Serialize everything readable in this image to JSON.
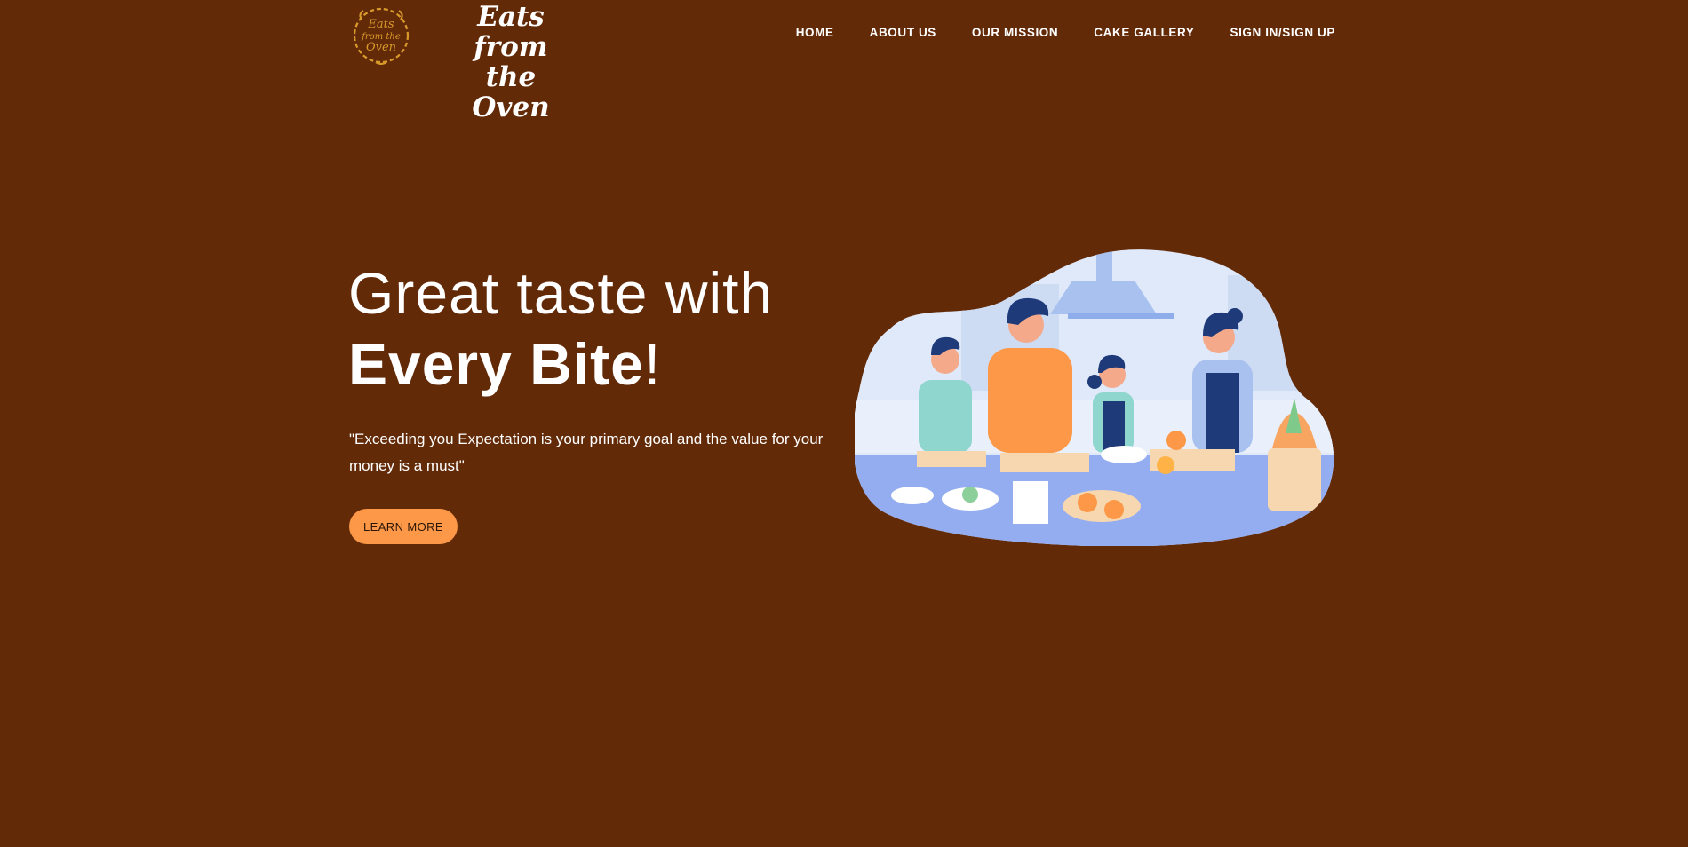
{
  "brand": {
    "emblem_text": [
      "Eats",
      "from the",
      "Oven"
    ],
    "wordmark_line1": "Eats from",
    "wordmark_line2": "the Oven",
    "accent": "#fc9847",
    "background": "#632a08",
    "emblem_color": "#d79a2b"
  },
  "nav": {
    "items": [
      {
        "label": "HOME"
      },
      {
        "label": "ABOUT US"
      },
      {
        "label": "OUR MISSION"
      },
      {
        "label": "CAKE GALLERY"
      },
      {
        "label": "SIGN IN/SIGN UP"
      }
    ]
  },
  "hero": {
    "title_line1": "Great taste with",
    "title_bold": "Every Bite",
    "title_suffix": "!",
    "quote": "\"Exceeding you Expectation is your primary goal and the value for your money is a must\"",
    "cta_label": "LEARN MORE",
    "illustration": "family-cooking-illustration"
  }
}
